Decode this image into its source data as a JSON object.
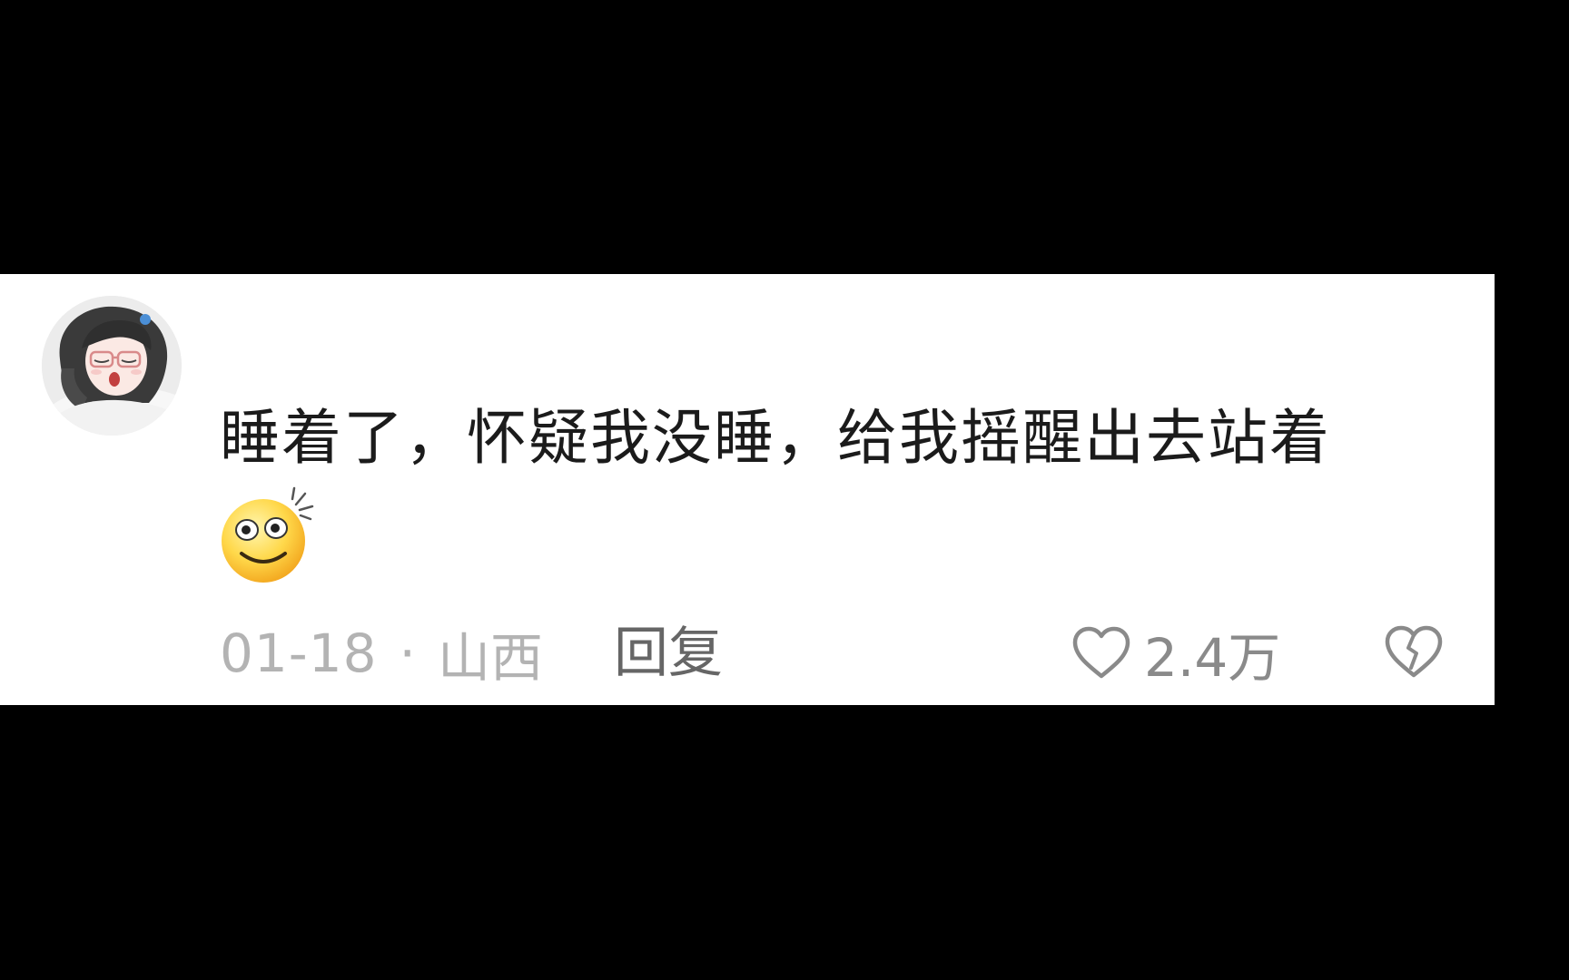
{
  "comment": {
    "text": "睡着了，怀疑我没睡，给我摇醒出去站着",
    "emoji": "dizzy-smile-emoji",
    "date": "01-18",
    "separator": "·",
    "location": "山西",
    "reply_label": "回复",
    "like_count": "2.4万"
  },
  "icons": {
    "like": "heart-outline-icon",
    "dislike": "broken-heart-icon"
  },
  "colors": {
    "card_background": "#ffffff",
    "page_background": "#000000",
    "text_primary": "#1b1b1b",
    "text_meta": "#b3b3b3",
    "text_reply": "#666666"
  }
}
